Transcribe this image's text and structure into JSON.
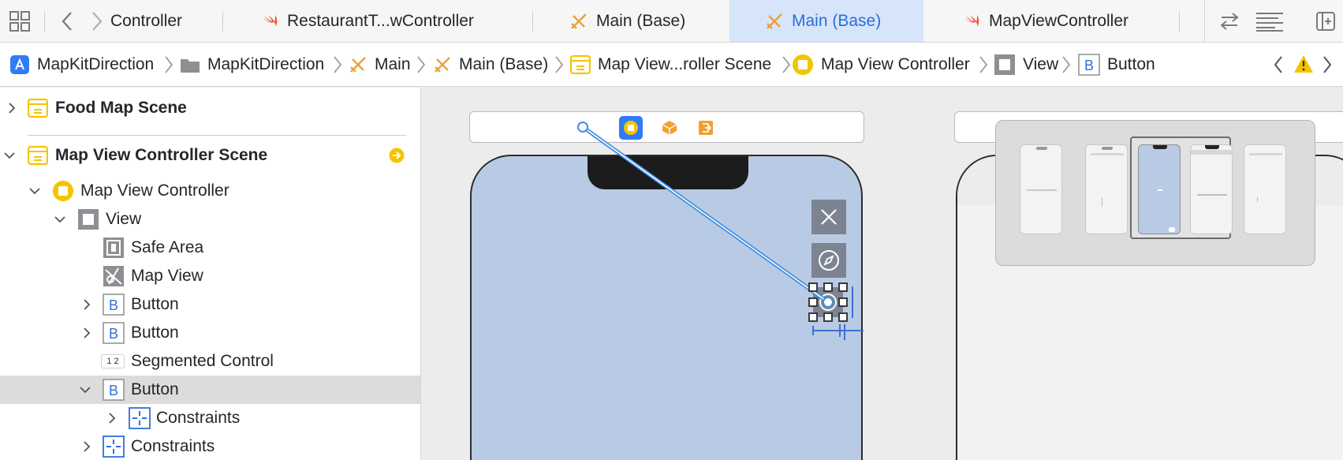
{
  "tabs": [
    {
      "label": "Controller",
      "icon": "none"
    },
    {
      "label": "RestaurantT...wController",
      "icon": "swift-icon"
    },
    {
      "label": "Main (Base)",
      "icon": "storyboard-icon"
    },
    {
      "label": "Main (Base)",
      "icon": "storyboard-icon",
      "active": true
    },
    {
      "label": "MapViewController",
      "icon": "swift-icon"
    }
  ],
  "breadcrumb": [
    {
      "label": "MapKitDirection",
      "icon": "app-icon"
    },
    {
      "label": "MapKitDirection",
      "icon": "folder-icon"
    },
    {
      "label": "Main",
      "icon": "storyboard-icon"
    },
    {
      "label": "Main (Base)",
      "icon": "storyboard-icon"
    },
    {
      "label": "Map View...roller Scene",
      "icon": "scene-icon"
    },
    {
      "label": "Map View Controller",
      "icon": "view-controller-icon"
    },
    {
      "label": "View",
      "icon": "view-icon"
    },
    {
      "label": "Button",
      "icon": "button-icon"
    }
  ],
  "outline": {
    "rows": [
      {
        "label": "Food Map Scene"
      },
      {
        "label": "Map View Controller Scene"
      },
      {
        "label": "Map View Controller"
      },
      {
        "label": "View"
      },
      {
        "label": "Safe Area"
      },
      {
        "label": "Map View"
      },
      {
        "label": "Button"
      },
      {
        "label": "Button"
      },
      {
        "label": "Segmented Control"
      },
      {
        "label": "Button"
      },
      {
        "label": "Constraints"
      },
      {
        "label": "Constraints"
      }
    ],
    "segmented_icon_text": "1 2",
    "button_icon_letter": "B"
  },
  "colors": {
    "accent": "#2a6ed8",
    "scene_yellow": "#f5c400",
    "phone_bg": "#b9cbe4",
    "selection": "#dcdcdc"
  }
}
